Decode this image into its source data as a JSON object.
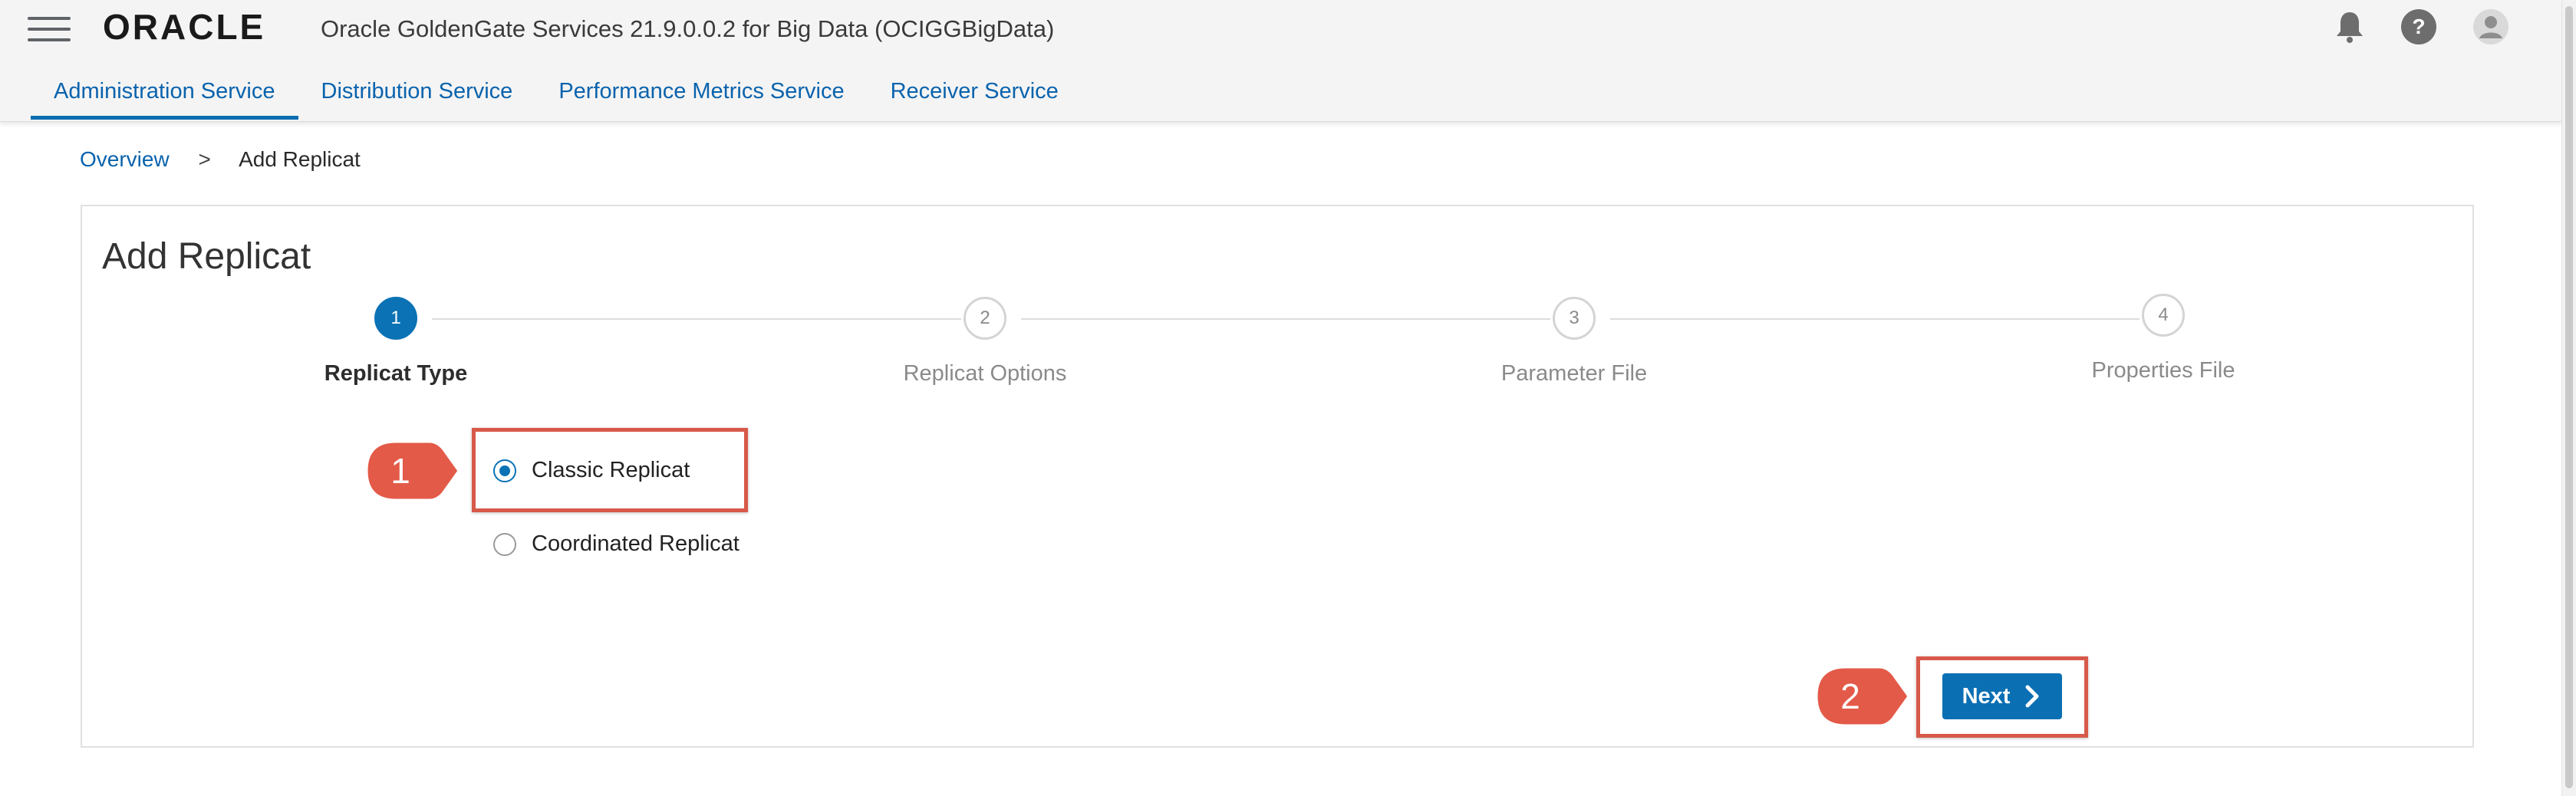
{
  "header": {
    "logo_text": "ORACLE",
    "app_title": "Oracle GoldenGate Services 21.9.0.0.2 for Big Data (OCIGGBigData)",
    "icons": [
      "menu-icon",
      "bell-icon",
      "help-icon",
      "user-icon"
    ]
  },
  "tabs": [
    {
      "label": "Administration Service",
      "active": true
    },
    {
      "label": "Distribution Service",
      "active": false
    },
    {
      "label": "Performance Metrics Service",
      "active": false
    },
    {
      "label": "Receiver Service",
      "active": false
    }
  ],
  "breadcrumb": {
    "link": "Overview",
    "separator": ">",
    "current": "Add Replicat"
  },
  "wizard": {
    "title": "Add Replicat",
    "current_step": 1,
    "steps": [
      {
        "number": "1",
        "label": "Replicat Type"
      },
      {
        "number": "2",
        "label": "Replicat Options"
      },
      {
        "number": "3",
        "label": "Parameter File"
      },
      {
        "number": "4",
        "label": "Properties File"
      }
    ],
    "options": [
      {
        "label": "Classic Replicat",
        "selected": true
      },
      {
        "label": "Coordinated Replicat",
        "selected": false
      }
    ],
    "next_label": "Next"
  },
  "annotations": {
    "callout_1": "1",
    "callout_2": "2"
  },
  "colors": {
    "accent": "#0b72b5",
    "link": "#0a63ad",
    "highlight": "#d8594a",
    "header_bg": "#f4f4f4"
  }
}
